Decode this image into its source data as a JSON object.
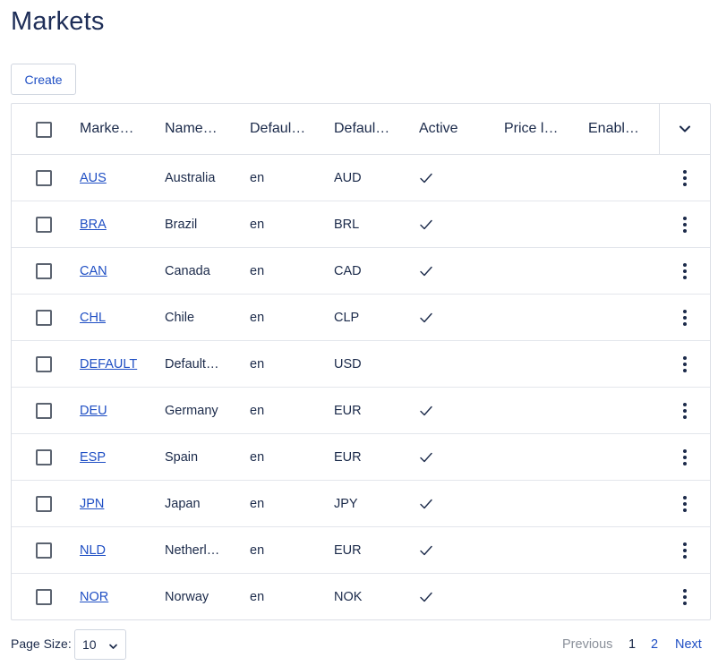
{
  "page": {
    "title": "Markets"
  },
  "toolbar": {
    "create_label": "Create"
  },
  "table": {
    "columns": [
      "Marke…",
      "Name…",
      "Defaul…",
      "Defaul…",
      "Active",
      "Price l…",
      "Enabl…"
    ],
    "rows": [
      {
        "code": "AUS",
        "name": "Australia",
        "language": "en",
        "currency": "AUD",
        "active": true
      },
      {
        "code": "BRA",
        "name": "Brazil",
        "language": "en",
        "currency": "BRL",
        "active": true
      },
      {
        "code": "CAN",
        "name": "Canada",
        "language": "en",
        "currency": "CAD",
        "active": true
      },
      {
        "code": "CHL",
        "name": "Chile",
        "language": "en",
        "currency": "CLP",
        "active": true
      },
      {
        "code": "DEFAULT",
        "name": "Default…",
        "language": "en",
        "currency": "USD",
        "active": false
      },
      {
        "code": "DEU",
        "name": "Germany",
        "language": "en",
        "currency": "EUR",
        "active": true
      },
      {
        "code": "ESP",
        "name": "Spain",
        "language": "en",
        "currency": "EUR",
        "active": true
      },
      {
        "code": "JPN",
        "name": "Japan",
        "language": "en",
        "currency": "JPY",
        "active": true
      },
      {
        "code": "NLD",
        "name": "Netherl…",
        "language": "en",
        "currency": "EUR",
        "active": true
      },
      {
        "code": "NOR",
        "name": "Norway",
        "language": "en",
        "currency": "NOK",
        "active": true
      }
    ]
  },
  "footer": {
    "page_size_label": "Page Size:",
    "page_size_value": "10",
    "previous_label": "Previous",
    "pages": [
      "1",
      "2"
    ],
    "current_page": "1",
    "next_label": "Next"
  },
  "icons": {
    "active": "check-icon",
    "row_menu": "kebab-menu-icon",
    "column_menu": "chevron-down-icon"
  },
  "colors": {
    "link": "#1f4fc4",
    "title": "#1d2d57",
    "border": "#dcdfe6",
    "disabled": "#8a909a"
  }
}
